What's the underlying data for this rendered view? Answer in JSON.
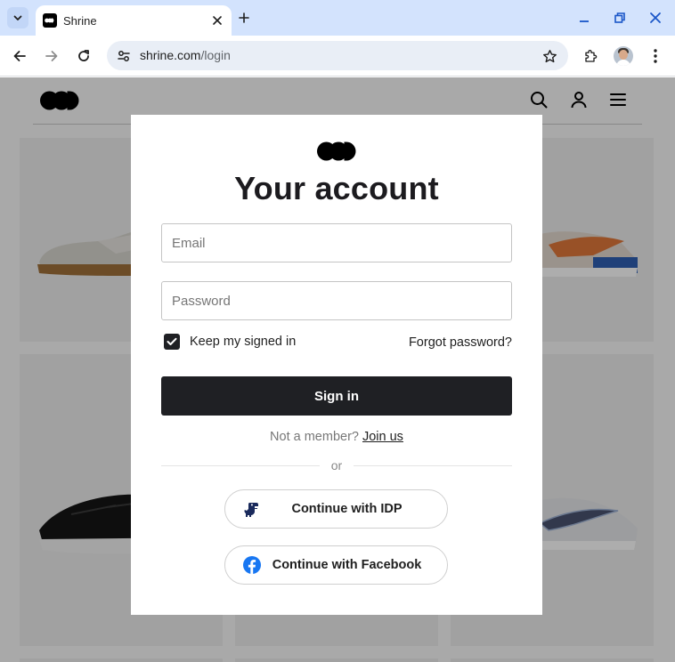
{
  "browser": {
    "tab_title": "Shrine",
    "url_host": "shrine.com",
    "url_path": "/login",
    "tab_list_icon": "chevron-down-icon",
    "new_tab_icon": "plus-icon",
    "window_controls": [
      "minimize-icon",
      "restore-icon",
      "close-icon"
    ],
    "accent_color": "#d3e3fd"
  },
  "site": {
    "logo_icon": "shrine-logo",
    "header_icons": [
      "search-icon",
      "account-icon",
      "menu-icon"
    ]
  },
  "modal": {
    "title": "Your account",
    "email_placeholder": "Email",
    "password_placeholder": "Password",
    "remember_label": "Keep my signed in",
    "remember_checked": true,
    "forgot_label": "Forgot password?",
    "signin_label": "Sign in",
    "member_prompt": "Not a member?",
    "join_label": "Join us",
    "divider_label": "or",
    "idp_label": "Continue with IDP",
    "facebook_label": "Continue with Facebook",
    "primary_color": "#1f2024",
    "facebook_color": "#1877f2"
  }
}
